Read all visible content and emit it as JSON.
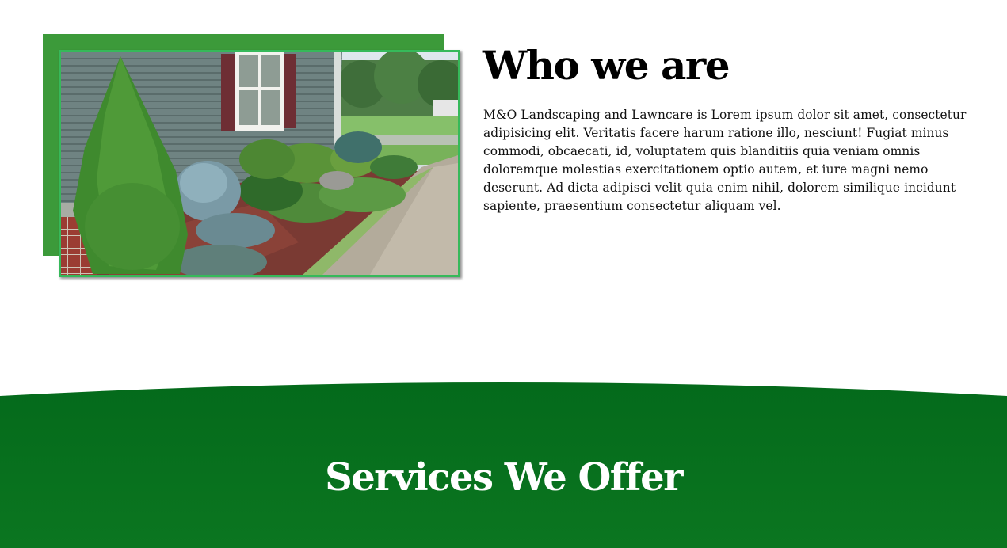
{
  "about": {
    "title": "Who we are",
    "body": "M&O Landscaping and Lawncare is Lorem ipsum dolor sit amet, consectetur adipisicing elit. Veritatis facere harum ratione illo, nesciunt! Fugiat minus commodi, obcaecati, id, voluptatem quis blanditiis quia veniam omnis doloremque molestias exercitationem optio autem, et iure magni nemo deserunt. Ad dicta adipisci velit quia enim nihil, dolorem similique incidunt sapiente, praesentium consectetur aliquam vel."
  },
  "services": {
    "title": "Services We Offer"
  },
  "colors": {
    "accent_green": "#3c9a3a",
    "frame_border": "#36b95a",
    "services_bg_top": "#046a1b",
    "services_bg_bottom": "#0b7620"
  }
}
